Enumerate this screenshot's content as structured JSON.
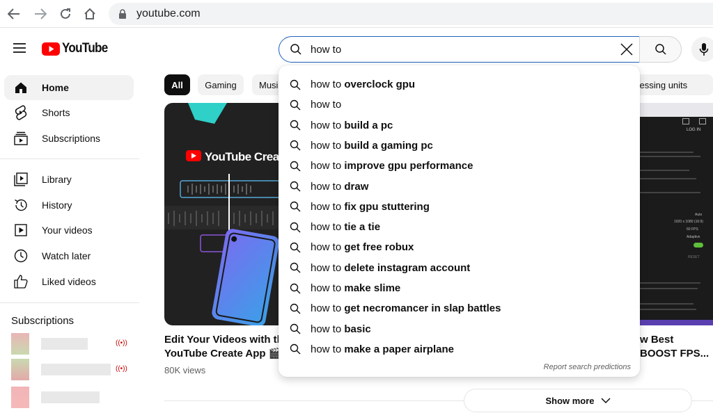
{
  "browser": {
    "url": "youtube.com"
  },
  "header": {
    "logo_text": "YouTube",
    "search_query": "how to",
    "brand_color": "#ff0000"
  },
  "sidebar": {
    "items": [
      {
        "label": "Home",
        "icon": "home-icon"
      },
      {
        "label": "Shorts",
        "icon": "shorts-icon"
      },
      {
        "label": "Subscriptions",
        "icon": "subscriptions-icon"
      },
      {
        "label": "Library",
        "icon": "library-icon"
      },
      {
        "label": "History",
        "icon": "history-icon"
      },
      {
        "label": "Your videos",
        "icon": "your-videos-icon"
      },
      {
        "label": "Watch later",
        "icon": "watch-later-icon"
      },
      {
        "label": "Liked videos",
        "icon": "liked-videos-icon"
      }
    ],
    "subscriptions_heading": "Subscriptions"
  },
  "chips": [
    {
      "label": "All"
    },
    {
      "label": "Gaming"
    },
    {
      "label": "Musi"
    },
    {
      "label": "cessing units"
    }
  ],
  "suggestions": [
    {
      "prefix": "how to ",
      "bold": "overclock gpu"
    },
    {
      "prefix": "how to",
      "bold": ""
    },
    {
      "prefix": "how to ",
      "bold": "build a pc"
    },
    {
      "prefix": "how to ",
      "bold": "build a gaming pc"
    },
    {
      "prefix": "how to ",
      "bold": "improve gpu performance"
    },
    {
      "prefix": "how to ",
      "bold": "draw"
    },
    {
      "prefix": "how to ",
      "bold": "fix gpu stuttering"
    },
    {
      "prefix": "how to ",
      "bold": "tie a tie"
    },
    {
      "prefix": "how to ",
      "bold": "get free robux"
    },
    {
      "prefix": "how to ",
      "bold": "delete instagram account"
    },
    {
      "prefix": "how to ",
      "bold": "make slime"
    },
    {
      "prefix": "how to ",
      "bold": "get necromancer in slap battles"
    },
    {
      "prefix": "how to ",
      "bold": "basic"
    },
    {
      "prefix": "how to ",
      "bold": "make a paper airplane"
    }
  ],
  "report_link": "Report search predictions",
  "videos": [
    {
      "title_line1": "Edit Your Videos with the",
      "title_line2": "YouTube Create App",
      "views": "80K views",
      "thumb_text": "YouTube Create"
    },
    {
      "title_line1": "w Best",
      "title_line2": "BOOST FPS..."
    }
  ],
  "show_more": "Show more",
  "thumb2": {
    "login": "LOG IN",
    "reset": "RESET",
    "settings": [
      "Auto",
      "1920 x 1080 (16:9)",
      "60 FPS",
      "Adaptive"
    ]
  }
}
